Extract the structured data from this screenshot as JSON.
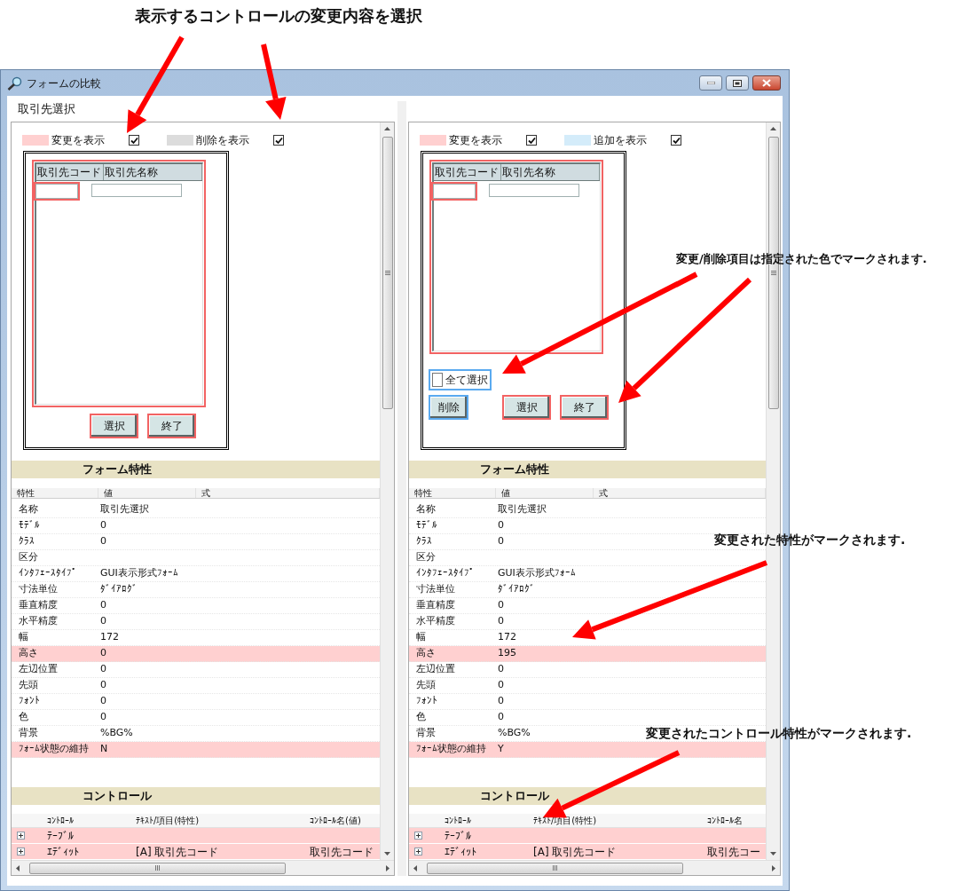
{
  "callouts": [
    {
      "text": "表示するコントロールの変更内容を選択"
    },
    {
      "text": "変更/削除項目は指定された色でマークされます."
    },
    {
      "text": "変更された特性がマークされます."
    },
    {
      "text": "変更されたコントロール特性がマークされます."
    }
  ],
  "window": {
    "title": "フォームの比較"
  },
  "panes": [
    {
      "header": "取引先選択",
      "legend": [
        {
          "label": "変更を表示",
          "checked": true,
          "color": "#ffd0d0"
        },
        {
          "label": "削除を表示",
          "checked": true,
          "color": "#dcdcdc"
        }
      ],
      "preview": {
        "grid": {
          "color": "#f26363",
          "columns": [
            "取引先コード",
            "取引先名称"
          ],
          "fields": [
            {
              "marked": true,
              "color": "#f26363"
            },
            {
              "marked": false
            }
          ]
        },
        "buttons": [
          {
            "label": "選択",
            "color": "#f26363"
          },
          {
            "label": "終了",
            "color": "#f26363"
          }
        ]
      },
      "form_properties": {
        "title": "フォーム特性",
        "columns": [
          "特性",
          "値",
          "式"
        ],
        "rows": [
          {
            "name": "名称",
            "value": "取引先選択",
            "changed": false
          },
          {
            "name": "ﾓﾃﾞﾙ",
            "value": "0",
            "changed": false
          },
          {
            "name": "ｸﾗｽ",
            "value": "0",
            "changed": false
          },
          {
            "name": "区分",
            "changed": false
          },
          {
            "name": "ｲﾝﾀﾌｪｰｽﾀｲﾌﾟ",
            "value": "GUI表示形式ﾌｫｰﾑ",
            "changed": false
          },
          {
            "name": "寸法単位",
            "value": "ﾀﾞｲｱﾛｸﾞ",
            "changed": false
          },
          {
            "name": "垂直精度",
            "value": "0",
            "changed": false
          },
          {
            "name": "水平精度",
            "value": "0",
            "changed": false
          },
          {
            "name": "幅",
            "value": "172",
            "changed": false
          },
          {
            "name": "高さ",
            "value": "0",
            "changed": true
          },
          {
            "name": "左辺位置",
            "value": "0",
            "changed": false
          },
          {
            "name": "先頭",
            "value": "0",
            "changed": false
          },
          {
            "name": "ﾌｫﾝﾄ",
            "value": "0",
            "changed": false
          },
          {
            "name": "色",
            "value": "0",
            "changed": false
          },
          {
            "name": "背景",
            "value": "%BG%",
            "changed": false
          },
          {
            "name": "ﾌｫｰﾑ状態の維持",
            "value": "N",
            "changed": true
          }
        ]
      },
      "controls": {
        "title": "コントロール",
        "columns": [
          "ｺﾝﾄﾛｰﾙ",
          "ﾃｷｽﾄ/項目(特性)",
          "ｺﾝﾄﾛｰﾙ名(値)"
        ],
        "rows": [
          {
            "control": "ﾃｰﾌﾞﾙ",
            "changed": true,
            "expanded": false
          },
          {
            "control": "ｴﾃﾞｨｯﾄ",
            "text": "[A] 取引先コード",
            "name": "取引先コード",
            "changed": true,
            "expanded": false
          }
        ]
      }
    },
    {
      "legend": [
        {
          "label": "変更を表示",
          "checked": true,
          "color": "#ffd0d0"
        },
        {
          "label": "追加を表示",
          "checked": true,
          "color": "#d4ecfa"
        }
      ],
      "preview": {
        "grid": {
          "color": "#f26363",
          "columns": [
            "取引先コード",
            "取引先名称"
          ],
          "fields": [
            {
              "marked": true,
              "color": "#f26363"
            },
            {
              "marked": false
            }
          ]
        },
        "select_all": {
          "label": "全て選択",
          "checked": false,
          "color": "#5aaaf0"
        },
        "buttons": [
          {
            "label": "削除",
            "color": "#5aaaf0"
          },
          {
            "label": "選択",
            "color": "#f26363"
          },
          {
            "label": "終了",
            "color": "#f26363"
          }
        ]
      },
      "form_properties": {
        "title": "フォーム特性",
        "columns": [
          "特性",
          "値",
          "式"
        ],
        "rows": [
          {
            "name": "名称",
            "value": "取引先選択",
            "changed": false
          },
          {
            "name": "ﾓﾃﾞﾙ",
            "value": "0",
            "changed": false
          },
          {
            "name": "ｸﾗｽ",
            "value": "0",
            "changed": false
          },
          {
            "name": "区分",
            "changed": false
          },
          {
            "name": "ｲﾝﾀﾌｪｰｽﾀｲﾌﾟ",
            "value": "GUI表示形式ﾌｫｰﾑ",
            "changed": false
          },
          {
            "name": "寸法単位",
            "value": "ﾀﾞｲｱﾛｸﾞ",
            "changed": false
          },
          {
            "name": "垂直精度",
            "value": "0",
            "changed": false
          },
          {
            "name": "水平精度",
            "value": "0",
            "changed": false
          },
          {
            "name": "幅",
            "value": "172",
            "changed": false
          },
          {
            "name": "高さ",
            "value": "195",
            "changed": true
          },
          {
            "name": "左辺位置",
            "value": "0",
            "changed": false
          },
          {
            "name": "先頭",
            "value": "0",
            "changed": false
          },
          {
            "name": "ﾌｫﾝﾄ",
            "value": "0",
            "changed": false
          },
          {
            "name": "色",
            "value": "0",
            "changed": false
          },
          {
            "name": "背景",
            "value": "%BG%",
            "changed": false
          },
          {
            "name": "ﾌｫｰﾑ状態の維持",
            "value": "Y",
            "changed": true
          }
        ]
      },
      "controls": {
        "title": "コントロール",
        "columns": [
          "ｺﾝﾄﾛｰﾙ",
          "ﾃｷｽﾄ/項目(特性)",
          "ｺﾝﾄﾛｰﾙ名"
        ],
        "rows": [
          {
            "control": "ﾃｰﾌﾞﾙ",
            "changed": true,
            "expanded": false
          },
          {
            "control": "ｴﾃﾞｨｯﾄ",
            "text": "[A] 取引先コード",
            "name": "取引先コー",
            "changed": true,
            "expanded": false
          }
        ]
      }
    }
  ]
}
